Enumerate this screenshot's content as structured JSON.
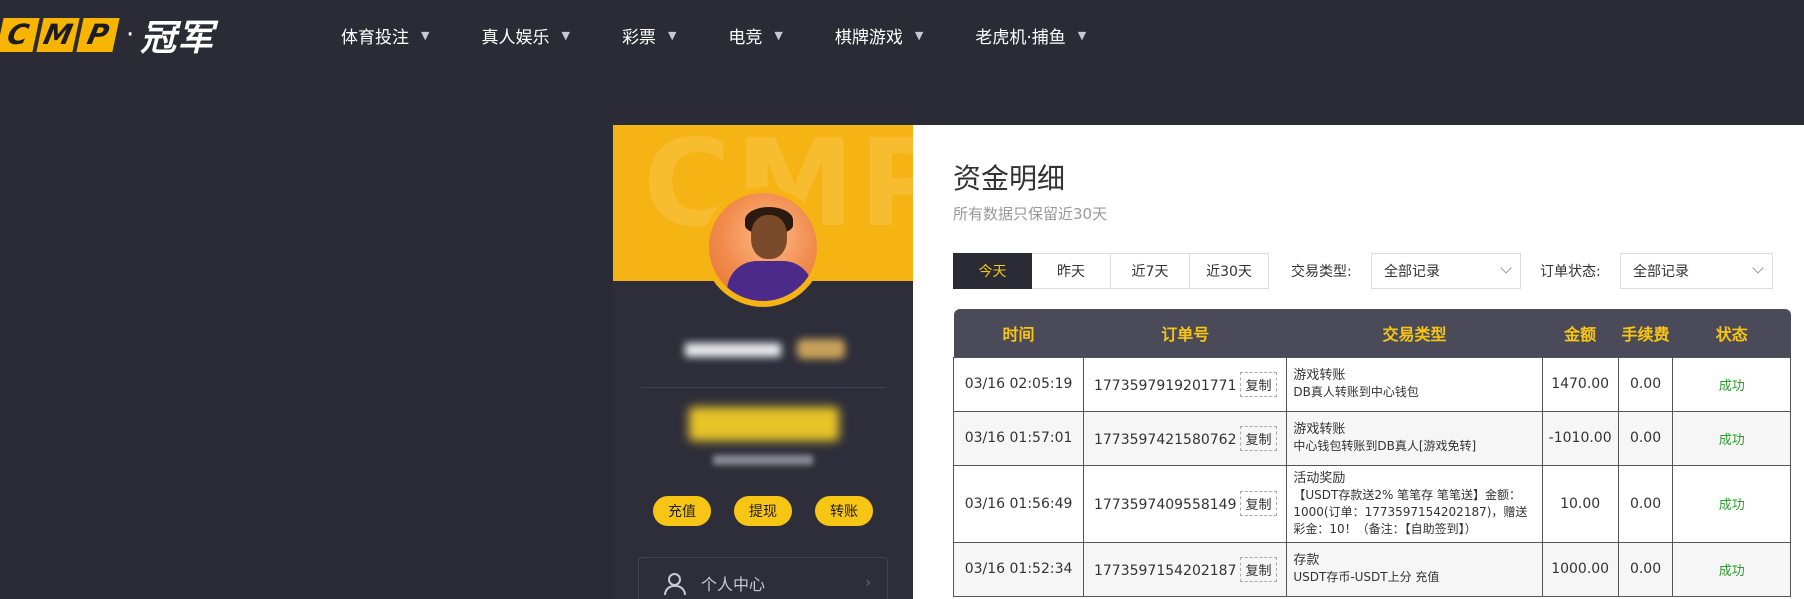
{
  "nav": {
    "brand": {
      "letters": [
        "C",
        "M",
        "P"
      ],
      "dot": "·",
      "name": "冠军"
    },
    "items": [
      {
        "label": "体育投注"
      },
      {
        "label": "真人娱乐"
      },
      {
        "label": "彩票"
      },
      {
        "label": "电竞"
      },
      {
        "label": "棋牌游戏"
      },
      {
        "label": "老虎机·捕鱼"
      }
    ]
  },
  "profile": {
    "banner_watermark": "CMP",
    "actions": {
      "recharge": "充值",
      "withdraw": "提现",
      "transfer": "转账"
    },
    "menu": {
      "personal_center": "个人中心"
    }
  },
  "page": {
    "title": "资金明细",
    "subtitle": "所有数据只保留近30天",
    "tabs": [
      "今天",
      "昨天",
      "近7天",
      "近30天"
    ],
    "active_tab": "今天",
    "filters": {
      "type_label": "交易类型:",
      "type_value": "全部记录",
      "status_label": "订单状态:",
      "status_value": "全部记录"
    }
  },
  "table": {
    "headers": [
      "时间",
      "订单号",
      "交易类型",
      "金额",
      "手续费",
      "状态"
    ],
    "copy_label": "复制",
    "rows": [
      {
        "time": "03/16 02:05:19",
        "order": "1773597919201771",
        "type_title": "游戏转账",
        "type_desc": "DB真人转账到中心钱包",
        "amount": "1470.00",
        "fee": "0.00",
        "status": "成功"
      },
      {
        "time": "03/16 01:57:01",
        "order": "1773597421580762",
        "type_title": "游戏转账",
        "type_desc": "中心钱包转账到DB真人[游戏免转]",
        "amount": "-1010.00",
        "fee": "0.00",
        "status": "成功"
      },
      {
        "time": "03/16 01:56:49",
        "order": "1773597409558149",
        "type_title": "活动奖励",
        "type_desc": "【USDT存款送2% 笔笔存 笔笔送】金额：1000(订单：1773597154202187)，赠送彩金：10！（备注：【自助签到】）",
        "amount": "10.00",
        "fee": "0.00",
        "status": "成功"
      },
      {
        "time": "03/16 01:52:34",
        "order": "1773597154202187",
        "type_title": "存款",
        "type_desc": "USDT存币-USDT上分 充值",
        "amount": "1000.00",
        "fee": "0.00",
        "status": "成功"
      }
    ]
  },
  "colors": {
    "accent": "#f7c514",
    "dark": "#2b2b36",
    "success": "#2a9d2a"
  },
  "icons": [
    "chevron-down-icon",
    "user-icon",
    "chevron-right-icon"
  ]
}
